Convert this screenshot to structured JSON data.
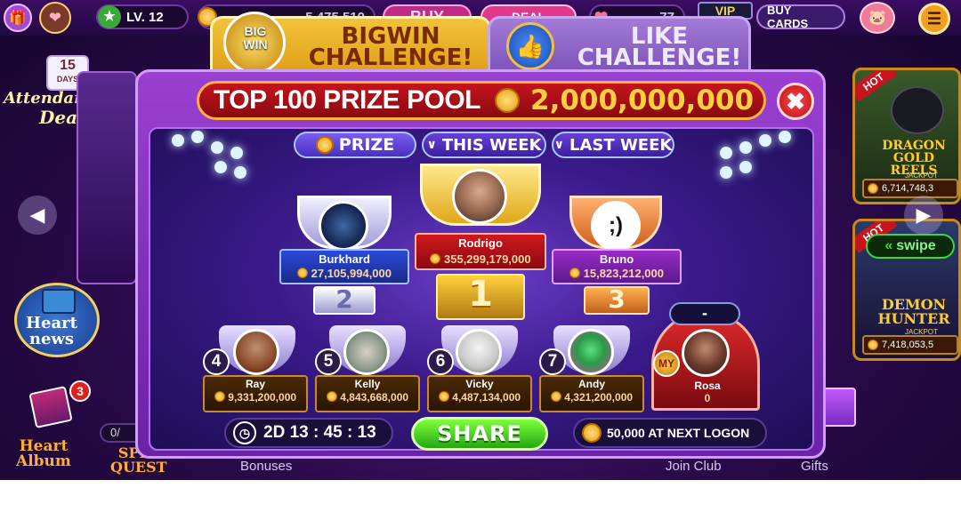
{
  "topbar": {
    "level": "LV. 12",
    "coins": "5,475,510",
    "buy_label": "BUY",
    "deal_label": "DEAL",
    "hearts": "77",
    "vip_label": "VIP",
    "buy_cards_label": "BUY CARDS"
  },
  "lobby_left": {
    "attendance_days": "15",
    "attendance_days_label": "DAYS",
    "attendance_title": "Attendance",
    "attendance_sub": "Deal",
    "heart_news": "Heart\nnews",
    "heart_album": "Heart\nAlbum",
    "album_badge": "3",
    "spin_quest": "SPIN\nQUEST",
    "quest_count": "0/"
  },
  "lobby_right": {
    "card1": {
      "hot": "HOT",
      "title": "DRAGON GOLD REELS",
      "jackpot_label": "JACKPOT",
      "jackpot": "6,714,748,3"
    },
    "card2": {
      "hot": "HOT",
      "title": "DEMON HUNTER",
      "jackpot_label": "JACKPOT",
      "jackpot": "7,418,053,5"
    },
    "swipe_label": "swipe"
  },
  "bottom_nav": {
    "bonuses": "Bonuses",
    "join_club": "Join Club",
    "gifts": "Gifts"
  },
  "dialog": {
    "tabs": [
      {
        "label": "BIGWIN\nCHALLENGE!",
        "trophy_text": "BIG\nWIN"
      },
      {
        "label": "LIKE\nCHALLENGE!"
      }
    ],
    "prize_pool_label": "TOP 100 PRIZE POOL",
    "prize_pool_value": "2,000,000,000",
    "filters": [
      "PRIZE",
      "THIS WEEK",
      "LAST WEEK"
    ],
    "podium": [
      {
        "rank": "1",
        "name": "Rodrigo",
        "score": "355,299,179,000"
      },
      {
        "rank": "2",
        "name": "Burkhard",
        "score": "27,105,994,000"
      },
      {
        "rank": "3",
        "name": "Bruno",
        "score": "15,823,212,000",
        "avatar_text": ";)"
      }
    ],
    "ranks": [
      {
        "rank": "4",
        "name": "Ray",
        "score": "9,331,200,000"
      },
      {
        "rank": "5",
        "name": "Kelly",
        "score": "4,843,668,000"
      },
      {
        "rank": "6",
        "name": "Vicky",
        "score": "4,487,134,000"
      },
      {
        "rank": "7",
        "name": "Andy",
        "score": "4,321,200,000"
      }
    ],
    "me": {
      "badge": "MY",
      "rank": "-",
      "name": "Rosa",
      "score": "0"
    },
    "timer": "2D 13 : 45 : 13",
    "share_label": "SHARE",
    "next_logon": "50,000 AT NEXT LOGON"
  }
}
